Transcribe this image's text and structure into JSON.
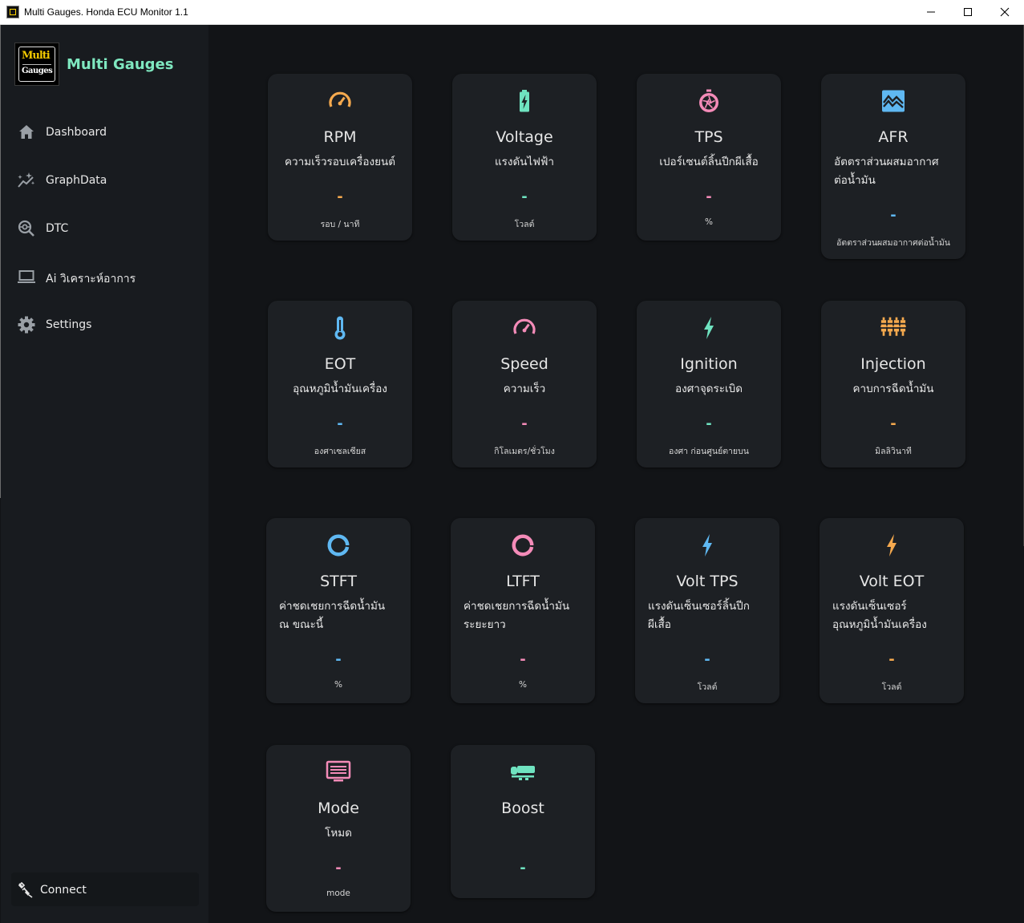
{
  "window": {
    "title": "Multi Gauges. Honda ECU Monitor 1.1"
  },
  "sidebar": {
    "logo": {
      "line1": "Multi",
      "line2": "Gauges"
    },
    "brand": "Multi Gauges",
    "items": [
      {
        "label": "Dashboard",
        "icon": "home-icon"
      },
      {
        "label": "GraphData",
        "icon": "sparkle-chart-icon"
      },
      {
        "label": "DTC",
        "icon": "diagnose-icon"
      },
      {
        "label": "Ai วิเคราะห์อาการ",
        "icon": "laptop-icon"
      },
      {
        "label": "Settings",
        "icon": "gear-icon"
      }
    ],
    "connect": {
      "label": "Connect",
      "icon": "plug-icon"
    }
  },
  "cards": [
    {
      "title": "RPM",
      "subtitle": "ความเร็วรอบเครื่องยนต์",
      "value": "-",
      "unit": "รอบ / นาที",
      "icon": "speedometer-icon",
      "color": "#f5a94e"
    },
    {
      "title": "Voltage",
      "subtitle": "แรงดันไฟฟ้า",
      "value": "-",
      "unit": "โวลต์",
      "icon": "battery-charging-icon",
      "color": "#6fe3c0"
    },
    {
      "title": "TPS",
      "subtitle": "เปอร์เซนต์ลิ้นปีกผีเสื้อ",
      "value": "-",
      "unit": "%",
      "icon": "throttle-aperture-icon",
      "color": "#f48bb8"
    },
    {
      "title": "AFR",
      "subtitle_lines": [
        "อัตตราส่วนผสมอากาศ",
        "ต่อน้ำมัน"
      ],
      "value": "-",
      "unit": "อัตตราส่วนผสมอากาศต่อน้ำมัน",
      "icon": "wave-chart-icon",
      "color": "#5fb8f2"
    },
    {
      "title": "EOT",
      "subtitle": "อุณหภูมิน้ำมันเครื่อง",
      "value": "-",
      "unit": "องศาเซลเซียส",
      "icon": "thermometer-icon",
      "color": "#5fb8f2"
    },
    {
      "title": "Speed",
      "subtitle": "ความเร็ว",
      "value": "-",
      "unit": "กิโลเมตร/ชั่วโมง",
      "icon": "speedometer-icon",
      "color": "#f48bb8"
    },
    {
      "title": "Ignition",
      "subtitle": "องศาจุดระเบิด",
      "value": "-",
      "unit": "องศา ก่อนศูนย์ตายบน",
      "icon": "lightning-icon",
      "color": "#6fe3c0"
    },
    {
      "title": "Injection",
      "subtitle": "คาบการฉีดน้ำมัน",
      "value": "-",
      "unit": "มิลลิวินาที",
      "icon": "injectors-icon",
      "color": "#f5a94e"
    },
    {
      "title": "STFT",
      "subtitle_lines": [
        "ค่าชดเชยการฉีดน้ำมัน",
        "ณ ขณะนี้"
      ],
      "value": "-",
      "unit": "%",
      "icon": "donut-icon",
      "color": "#5fb8f2"
    },
    {
      "title": "LTFT",
      "subtitle_lines": [
        "ค่าชดเชยการฉีดน้ำมัน",
        "ระยะยาว"
      ],
      "value": "-",
      "unit": "%",
      "icon": "donut-icon",
      "color": "#f48bb8"
    },
    {
      "title": "Volt TPS",
      "subtitle_lines": [
        "แรงดันเซ็นเซอร์ลิ้นปีก",
        "ผีเสื้อ"
      ],
      "value": "-",
      "unit": "โวลต์",
      "icon": "lightning-icon",
      "color": "#5fb8f2"
    },
    {
      "title": "Volt EOT",
      "subtitle_lines": [
        "แรงดันเซ็นเซอร์",
        "อุณหภูมิน้ำมันเครื่อง"
      ],
      "value": "-",
      "unit": "โวลต์",
      "icon": "lightning-icon",
      "color": "#f5a94e"
    },
    {
      "title": "Mode",
      "subtitle": "โหมด",
      "value": "-",
      "unit": "mode",
      "icon": "monitor-icon",
      "color": "#f48bb8"
    },
    {
      "title": "Boost",
      "value": "-",
      "icon": "turbo-icon",
      "color": "#6fe3c0"
    }
  ]
}
